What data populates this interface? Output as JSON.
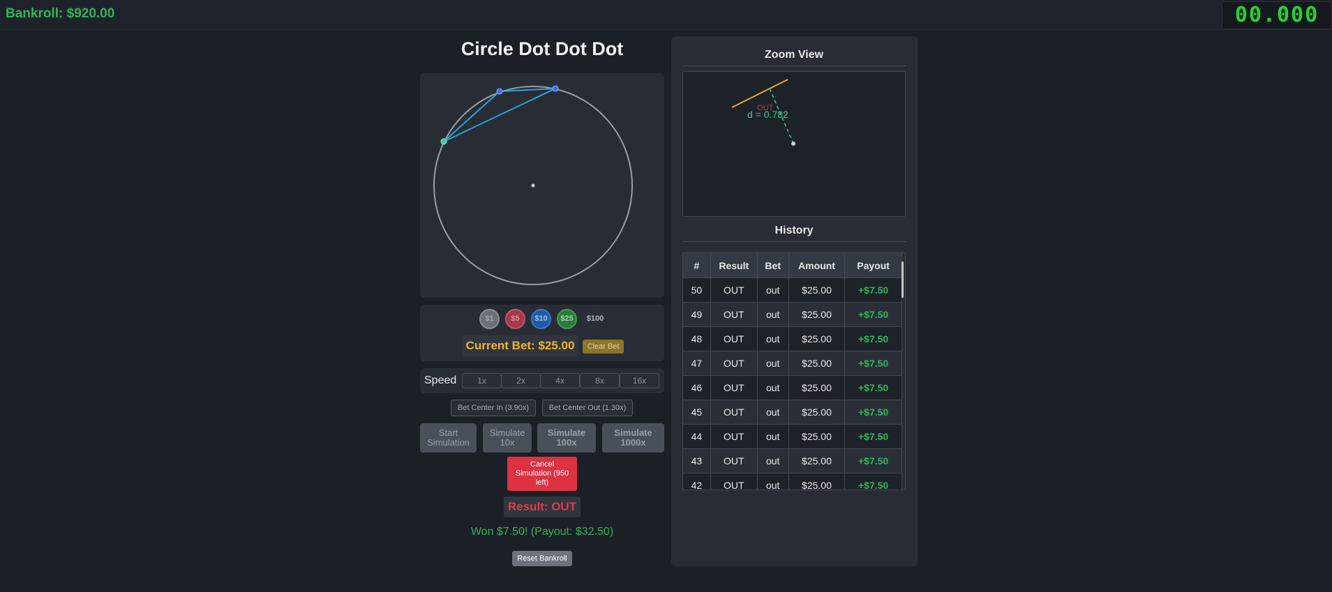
{
  "header": {
    "bankroll": "Bankroll: $920.00",
    "timer": "00.000"
  },
  "game": {
    "title": "Circle Dot Dot Dot"
  },
  "chips": [
    {
      "label": "$1",
      "color": "#6b7079"
    },
    {
      "label": "$5",
      "color": "#a33a4a"
    },
    {
      "label": "$10",
      "color": "#1f5ba6"
    },
    {
      "label": "$25",
      "color": "#2e7a3c"
    },
    {
      "label": "$100",
      "color": "#2a2f37"
    }
  ],
  "bet": {
    "current": "Current Bet: $25.00",
    "clear_label": "Clear Bet"
  },
  "speed": {
    "label": "Speed",
    "options": [
      "1x",
      "2x",
      "4x",
      "8x",
      "16x"
    ]
  },
  "bet_types": {
    "center_in": "Bet Center In (3.90x)",
    "center_out": "Bet Center Out (1.30x)"
  },
  "simulation": {
    "start": "Start Simulation",
    "sim10": "Simulate 10x",
    "sim100": "Simulate 100x",
    "sim1000": "Simulate 1000x",
    "cancel": "Cancel Simulation (950 left)"
  },
  "outcome": {
    "result": "Result: OUT",
    "won": "Won $7.50! (Payout: $32.50)",
    "reset": "Reset Bankroll"
  },
  "zoom": {
    "title": "Zoom View",
    "out_label": "OUT",
    "distance": "d = 0.782"
  },
  "history": {
    "title": "History",
    "columns": [
      "#",
      "Result",
      "Bet",
      "Amount",
      "Payout"
    ],
    "rows": [
      [
        "50",
        "OUT",
        "out",
        "$25.00",
        "+$7.50"
      ],
      [
        "49",
        "OUT",
        "out",
        "$25.00",
        "+$7.50"
      ],
      [
        "48",
        "OUT",
        "out",
        "$25.00",
        "+$7.50"
      ],
      [
        "47",
        "OUT",
        "out",
        "$25.00",
        "+$7.50"
      ],
      [
        "46",
        "OUT",
        "out",
        "$25.00",
        "+$7.50"
      ],
      [
        "45",
        "OUT",
        "out",
        "$25.00",
        "+$7.50"
      ],
      [
        "44",
        "OUT",
        "out",
        "$25.00",
        "+$7.50"
      ],
      [
        "43",
        "OUT",
        "out",
        "$25.00",
        "+$7.50"
      ],
      [
        "42",
        "OUT",
        "out",
        "$25.00",
        "+$7.50"
      ]
    ]
  }
}
